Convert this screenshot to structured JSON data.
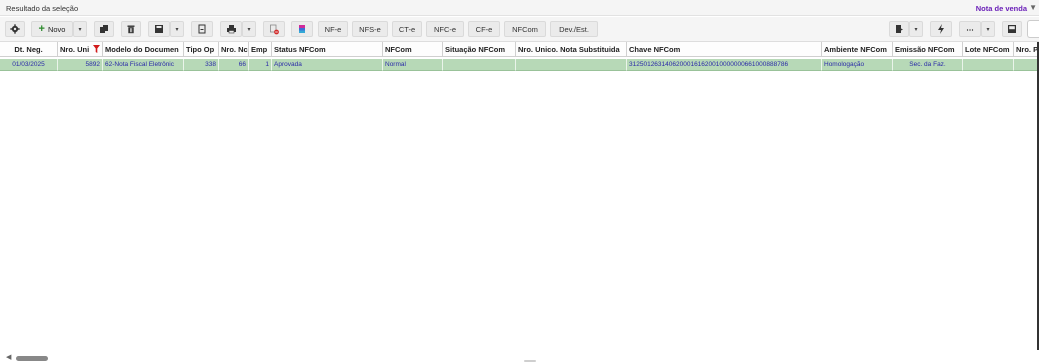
{
  "window": {
    "title": "Resultado da seleção",
    "right_link": "Nota de venda"
  },
  "toolbar": {
    "novo_label": "Novo",
    "doc_buttons": [
      "NF-e",
      "NFS-e",
      "CT-e",
      "NFC-e",
      "CF-e",
      "NFCom",
      "Dev./Est."
    ]
  },
  "table": {
    "columns": [
      "Dt. Neg.",
      "Nro. Uni",
      "Modelo do Documen",
      "Tipo Op",
      "Nro. Nc",
      "Emp",
      "Status NFCom",
      "NFCom",
      "Situação NFCom",
      "Nro. Unico. Nota Substituida",
      "Chave NFCom",
      "Ambiente NFCom",
      "Emissão NFCom",
      "Lote NFCom",
      "Nro. P"
    ],
    "rows": [
      {
        "dt_neg": "01/03/2025",
        "nro_unico": "5892",
        "modelo": "62-Nota Fiscal Eletrônic",
        "tipo_op": "338",
        "nro_nota": "66",
        "emp": "1",
        "status": "Aprovada",
        "nfcom": "Normal",
        "situacao": "",
        "nro_subst": "",
        "chave": "31250126314062000161620010000000661000888786",
        "ambiente": "Homologação",
        "emissao": "Sec. da Faz.",
        "lote": "",
        "nro_p": ""
      }
    ]
  },
  "colors": {
    "row_selected_bg": "#b7d9b7",
    "row_text": "#2a2aa8",
    "accent_link": "#6a1fb8",
    "filter_icon": "#d11a1a",
    "novo_plus": "#2e8b2e"
  }
}
